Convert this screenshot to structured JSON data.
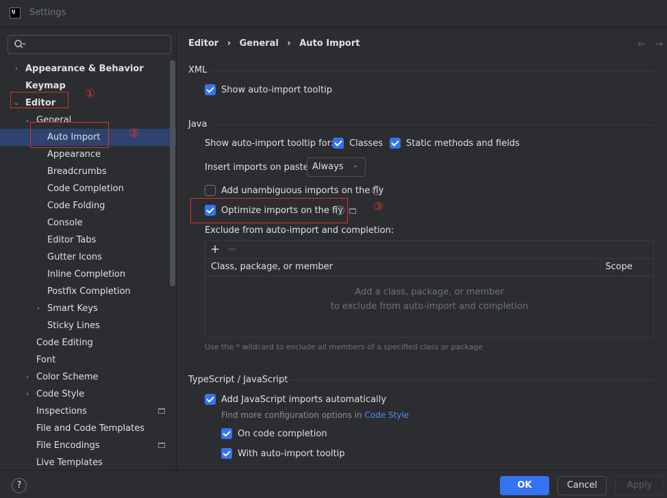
{
  "window": {
    "title": "Settings",
    "logo_text": "IJ"
  },
  "search": {
    "placeholder": ""
  },
  "tree": {
    "appearance_behavior": "Appearance & Behavior",
    "keymap": "Keymap",
    "editor": "Editor",
    "general": "General",
    "auto_import": "Auto Import",
    "appearance": "Appearance",
    "breadcrumbs": "Breadcrumbs",
    "code_completion": "Code Completion",
    "code_folding": "Code Folding",
    "console": "Console",
    "editor_tabs": "Editor Tabs",
    "gutter_icons": "Gutter Icons",
    "inline_completion": "Inline Completion",
    "postfix_completion": "Postfix Completion",
    "smart_keys": "Smart Keys",
    "sticky_lines": "Sticky Lines",
    "code_editing": "Code Editing",
    "font": "Font",
    "color_scheme": "Color Scheme",
    "code_style": "Code Style",
    "inspections": "Inspections",
    "file_code_templates": "File and Code Templates",
    "file_encodings": "File Encodings",
    "live_templates": "Live Templates"
  },
  "annotations": {
    "one": "①",
    "two": "②",
    "three": "③"
  },
  "breadcrumb": {
    "editor": "Editor",
    "sep1": "›",
    "general": "General",
    "sep2": "›",
    "auto_import": "Auto Import"
  },
  "nav": {
    "back": "←",
    "forward": "→"
  },
  "xml": {
    "title": "XML",
    "show_tooltip": "Show auto-import tooltip"
  },
  "java": {
    "title": "Java",
    "show_tooltip_for": "Show auto-import tooltip for:",
    "classes": "Classes",
    "static_methods": "Static methods and fields",
    "insert_imports_label": "Insert imports on paste:",
    "insert_imports_value": "Always",
    "add_unambiguous": "Add unambiguous imports on the fly",
    "optimize_imports": "Optimize imports on the fly",
    "exclude_label": "Exclude from auto-import and completion:",
    "add_icon": "+",
    "remove_icon": "−",
    "col_class": "Class, package, or member",
    "col_scope": "Scope",
    "empty_line1": "Add a class, package, or member",
    "empty_line2": "to exclude from auto-import and completion",
    "wildcard_hint": "Use the * wildcard to exclude all members of a specified class or package"
  },
  "ts": {
    "title": "TypeScript / JavaScript",
    "add_js_imports": "Add JavaScript imports automatically",
    "find_more": "Find more configuration options in",
    "code_style_link": "Code Style",
    "on_completion": "On code completion",
    "with_tooltip": "With auto-import tooltip"
  },
  "footer": {
    "help": "?",
    "ok": "OK",
    "cancel": "Cancel",
    "apply": "Apply"
  },
  "colors": {
    "accent": "#3574f0",
    "selection": "#2e436e",
    "annotation": "#e0322f"
  }
}
